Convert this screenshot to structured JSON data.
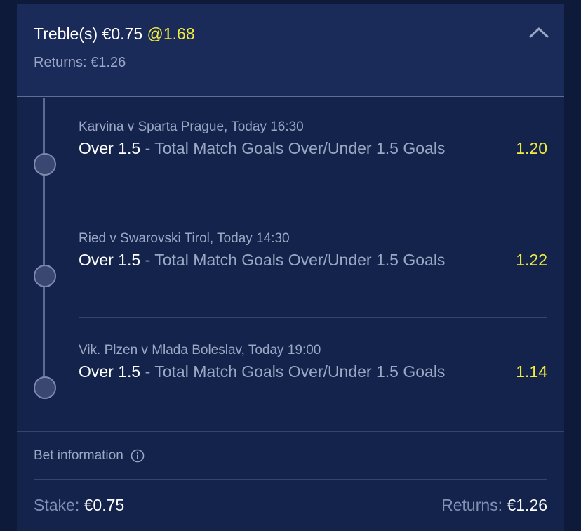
{
  "bet": {
    "type_label": "Treble(s)",
    "stake_amount": "€0.75",
    "odds": "@1.68",
    "returns_label": "Returns:",
    "returns_value": "€1.26"
  },
  "selections": [
    {
      "event": "Karvina v Sparta Prague, Today 16:30",
      "pick": "Over 1.5",
      "separator": " - ",
      "market": "Total Match Goals Over/Under 1.5 Goals",
      "odds": "1.20"
    },
    {
      "event": "Ried v Swarovski Tirol, Today 14:30",
      "pick": "Over 1.5",
      "separator": " - ",
      "market": "Total Match Goals Over/Under 1.5 Goals",
      "odds": "1.22"
    },
    {
      "event": "Vik. Plzen v Mlada Boleslav, Today 19:00",
      "pick": "Over 1.5",
      "separator": " - ",
      "market": "Total Match Goals Over/Under 1.5 Goals",
      "odds": "1.14"
    }
  ],
  "bet_information": {
    "label": "Bet information",
    "icon": "info-icon"
  },
  "footer": {
    "stake_label": "Stake:",
    "stake_value": "€0.75",
    "returns_label": "Returns:",
    "returns_value": "€1.26"
  },
  "icons": {
    "collapse": "chevron-up-icon"
  },
  "colors": {
    "background": "#0d1a3a",
    "card": "#14234b",
    "header": "#1b2b59",
    "odds_accent": "#f3ec3f",
    "muted_text": "#9aa7c5"
  }
}
